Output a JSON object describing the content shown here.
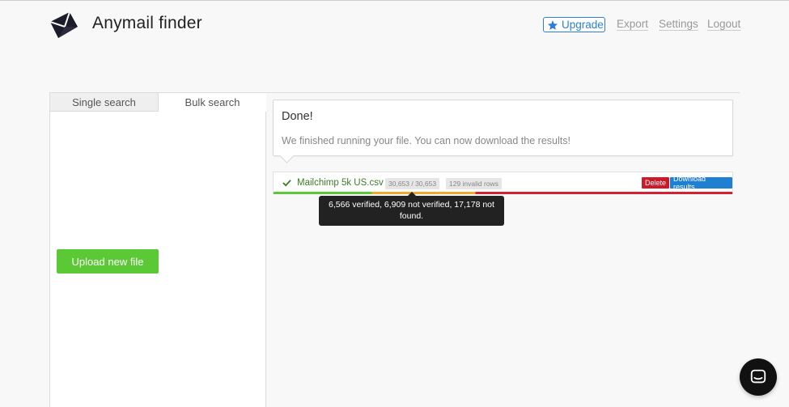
{
  "app": {
    "brand": "Anymail finder"
  },
  "header": {
    "upgrade_label": "Upgrade",
    "export_label": "Export",
    "settings_label": "Settings",
    "logout_label": "Logout"
  },
  "tabs": {
    "single_search": "Single search",
    "bulk_search": "Bulk search",
    "active": "bulk_search"
  },
  "upload": {
    "label": "Upload new file"
  },
  "notice": {
    "title": "Done!",
    "message": "We finished running your file. You can now download the results!"
  },
  "file": {
    "name": "Mailchimp 5k US.csv",
    "progress_count": "30,653 / 30,653",
    "invalid_rows": "129 invalid rows",
    "delete_label": "Delete",
    "download_label": "Download results",
    "tooltip": "6,566 verified, 6,909 not verified, 17,178 not found.",
    "stats": {
      "verified": 6566,
      "not_verified": 6909,
      "not_found": 17178
    }
  },
  "colors": {
    "accent_blue": "#2c7fd6",
    "success_green": "#5ac935",
    "danger_red": "#cc1a2a",
    "warning_orange": "#f0a830"
  },
  "icons": {
    "logo": "envelope-logo-icon",
    "upgrade": "star-icon",
    "file_status": "check-icon",
    "chat": "chat-bubble-icon"
  }
}
